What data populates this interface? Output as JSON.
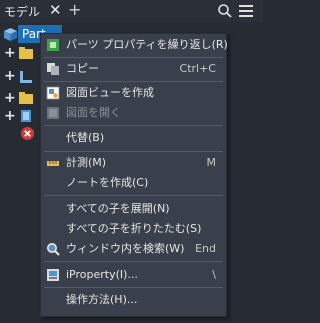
{
  "panel": {
    "tab_label": "モデル",
    "close_glyph": "✕",
    "add_glyph": "+",
    "tree_root_label": "Part"
  },
  "context_menu": {
    "items": [
      {
        "label": "パーツ プロパティを繰り返し(R)",
        "shortcut": "",
        "icon": "repeat-properties-icon",
        "disabled": false
      },
      {
        "label": "コピー",
        "shortcut": "Ctrl+C",
        "icon": "copy-icon",
        "disabled": false
      },
      {
        "label": "図面ビューを作成",
        "shortcut": "",
        "icon": "drawing-view-icon",
        "disabled": false
      },
      {
        "label": "図面を開く",
        "shortcut": "",
        "icon": "",
        "disabled": true
      },
      {
        "label": "代替(B)",
        "shortcut": "",
        "icon": "",
        "disabled": false
      },
      {
        "label": "計測(M)",
        "shortcut": "M",
        "icon": "measure-icon",
        "disabled": false
      },
      {
        "label": "ノートを作成(C)",
        "shortcut": "",
        "icon": "",
        "disabled": false
      },
      {
        "label": "すべての子を展開(N)",
        "shortcut": "",
        "icon": "",
        "disabled": false
      },
      {
        "label": "すべての子を折りたたむ(S)",
        "shortcut": "",
        "icon": "",
        "disabled": false
      },
      {
        "label": "ウィンドウ内を検索(W)",
        "shortcut": "End",
        "icon": "find-in-window-icon",
        "disabled": false
      },
      {
        "label": "iProperty(I)...",
        "shortcut": "\\",
        "icon": "iproperty-icon",
        "disabled": false
      },
      {
        "label": "操作方法(H)...",
        "shortcut": "",
        "icon": "",
        "disabled": false
      }
    ]
  },
  "colors": {
    "background": "#272b34",
    "menu_background": "#3a404b",
    "selection": "#1f6fb7"
  }
}
